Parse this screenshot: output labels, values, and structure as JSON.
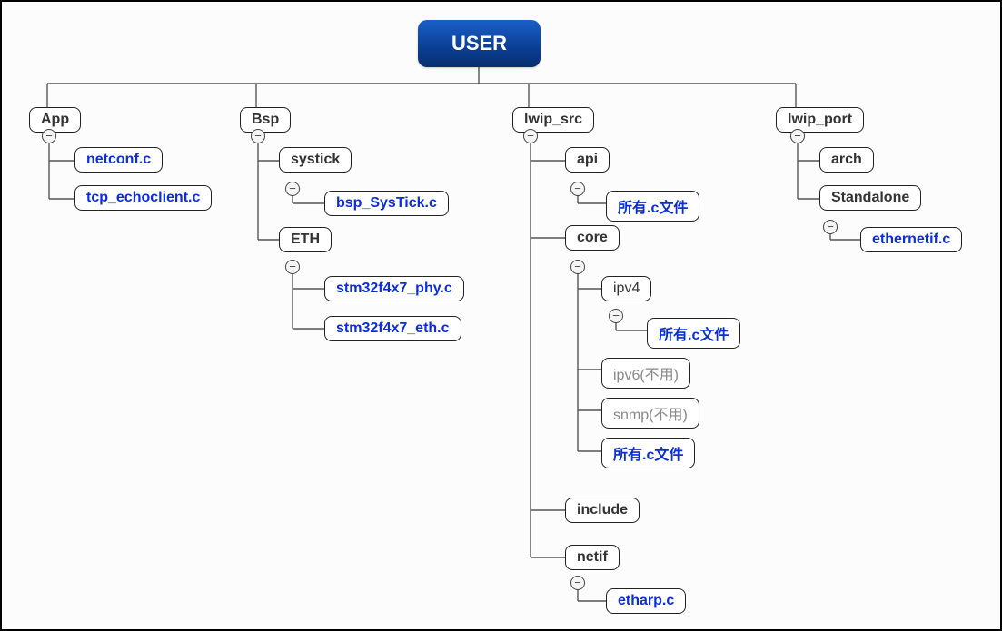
{
  "root": "USER",
  "branches": {
    "app": {
      "label": "App",
      "children": [
        "netconf.c",
        "tcp_echoclient.c"
      ]
    },
    "bsp": {
      "label": "Bsp",
      "systick": {
        "label": "systick",
        "children": [
          "bsp_SysTick.c"
        ]
      },
      "eth": {
        "label": "ETH",
        "children": [
          "stm32f4x7_phy.c",
          "stm32f4x7_eth.c"
        ]
      }
    },
    "lwip_src": {
      "label": "lwip_src",
      "api": {
        "label": "api",
        "children": [
          "所有.c文件"
        ]
      },
      "core": {
        "label": "core",
        "ipv4": {
          "label": "ipv4",
          "children": [
            "所有.c文件"
          ]
        },
        "ipv6": "ipv6(不用)",
        "snmp": "snmp(不用)",
        "all": "所有.c文件"
      },
      "include": "include",
      "netif": {
        "label": "netif",
        "children": [
          "etharp.c"
        ]
      }
    },
    "lwip_port": {
      "label": "lwip_port",
      "arch": "arch",
      "standalone": {
        "label": "Standalone",
        "children": [
          "ethernetif.c"
        ]
      }
    }
  }
}
